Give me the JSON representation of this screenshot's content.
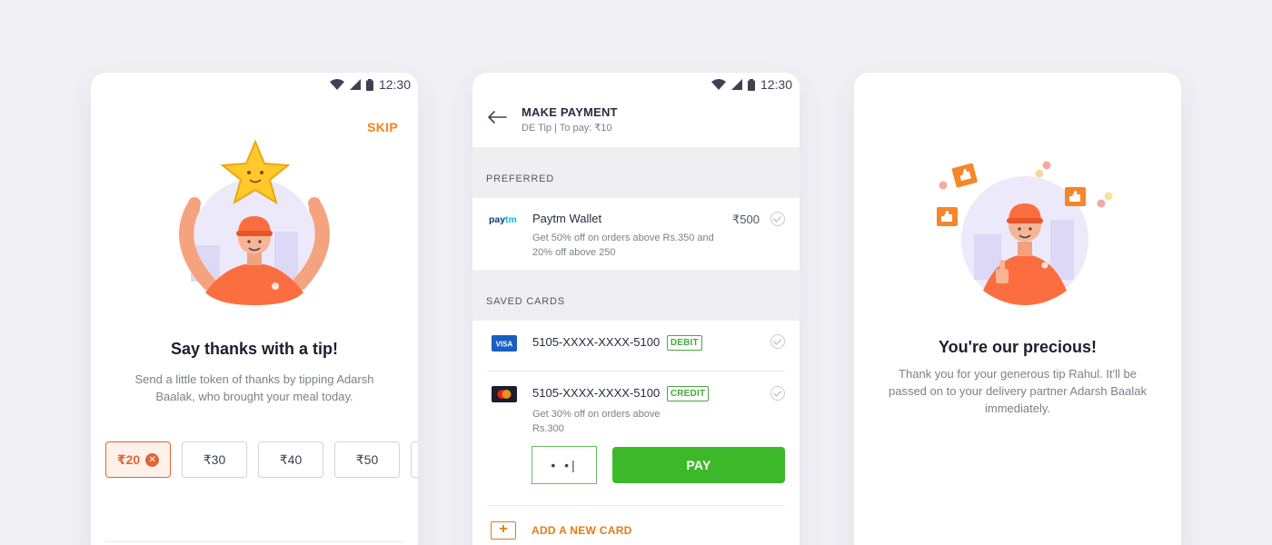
{
  "status": {
    "time": "12:30"
  },
  "tip_screen": {
    "skip_label": "SKIP",
    "title": "Say thanks with a tip!",
    "subtitle": "Send a little token of thanks by tipping Adarsh Baalak, who brought your meal today.",
    "options": [
      {
        "label": "₹20",
        "selected": true
      },
      {
        "label": "₹30",
        "selected": false
      },
      {
        "label": "₹40",
        "selected": false
      },
      {
        "label": "₹50",
        "selected": false
      }
    ],
    "colors": {
      "accent": "#e06537",
      "skip": "#fc8019"
    }
  },
  "payment_screen": {
    "title": "MAKE PAYMENT",
    "subtitle": "DE Tip | To pay: ₹10",
    "preferred_header": "PREFERRED",
    "wallet": {
      "logo_text": "paytm",
      "name": "Paytm Wallet",
      "amount": "₹500",
      "offer": "Get 50% off on orders above Rs.350 and 20% off above 250"
    },
    "saved_cards_header": "SAVED CARDS",
    "cards": [
      {
        "brand": "visa-icon",
        "brand_text": "VISA",
        "number": "5105-XXXX-XXXX-5100",
        "type": "DEBIT"
      },
      {
        "brand": "mastercard-icon",
        "number": "5105-XXXX-XXXX-5100",
        "type": "CREDIT",
        "offer": "Get 30% off on orders above Rs.300"
      }
    ],
    "cvv_value": "• •|",
    "pay_label": "PAY",
    "add_card_label": "ADD A NEW CARD",
    "colors": {
      "pay": "#3eb82b",
      "add": "#e47d15",
      "tag": "#48a93d"
    }
  },
  "thanks_screen": {
    "title": "You're our precious!",
    "message": "Thank you for your generous tip Rahul. It'll be passed on to your delivery partner Adarsh Baalak immediately."
  }
}
